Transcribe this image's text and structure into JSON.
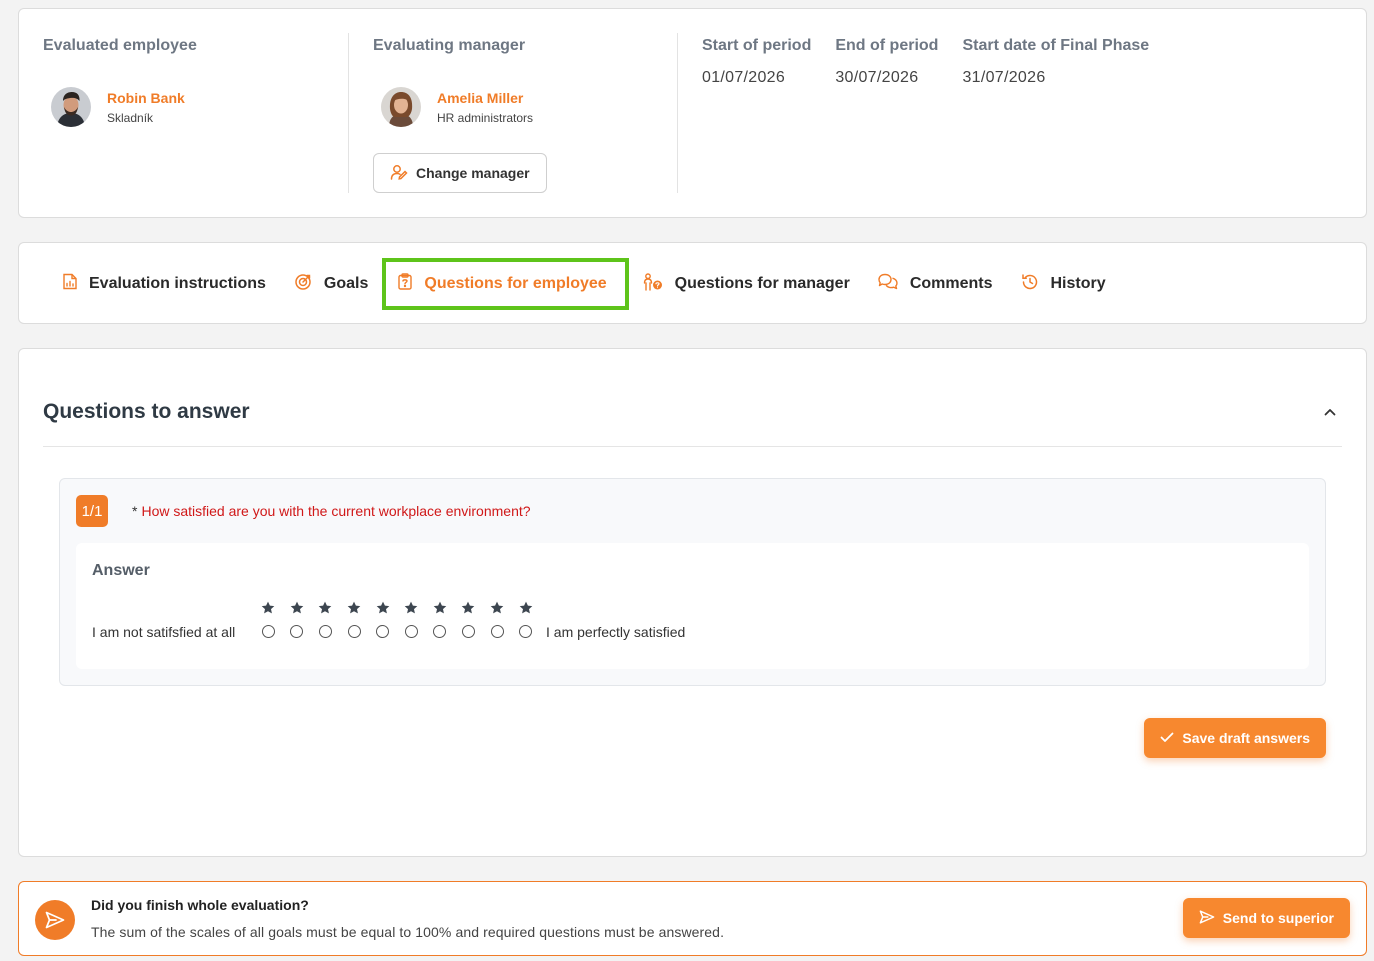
{
  "employee": {
    "section_title": "Evaluated employee",
    "name": "Robin Bank",
    "role": "Skladník"
  },
  "manager": {
    "section_title": "Evaluating manager",
    "name": "Amelia Miller",
    "role": "HR administrators",
    "change_button": "Change manager"
  },
  "dates": {
    "start_label": "Start of period",
    "start_value": "01/07/2026",
    "end_label": "End of period",
    "end_value": "30/07/2026",
    "final_label": "Start date of Final Phase",
    "final_value": "31/07/2026"
  },
  "tabs": [
    {
      "label": "Evaluation instructions",
      "icon": "document-icon",
      "active": false
    },
    {
      "label": "Goals",
      "icon": "target-icon",
      "active": false
    },
    {
      "label": "Questions for employee",
      "icon": "clipboard-icon",
      "active": true
    },
    {
      "label": "Questions for manager",
      "icon": "manager-question-icon",
      "active": false
    },
    {
      "label": "Comments",
      "icon": "chat-icon",
      "active": false
    },
    {
      "label": "History",
      "icon": "history-icon",
      "active": false
    }
  ],
  "questions": {
    "title": "Questions to answer",
    "question_number": "1/1",
    "required_mark": "*",
    "question_text": "How satisfied are you with the current workplace environment?",
    "answer_label": "Answer",
    "scale_low": "I am not satifsfied at all",
    "scale_high": "I am perfectly satisfied",
    "scale_points": 10,
    "selected": null,
    "save_button": "Save draft answers"
  },
  "banner": {
    "title": "Did you finish whole evaluation?",
    "text": "The sum of the scales of all goals must be equal to 100% and required questions must be answered.",
    "send_button": "Send to superior"
  },
  "colors": {
    "accent": "#f07c28",
    "highlight": "#5ec41a",
    "required_text": "#d01818"
  }
}
